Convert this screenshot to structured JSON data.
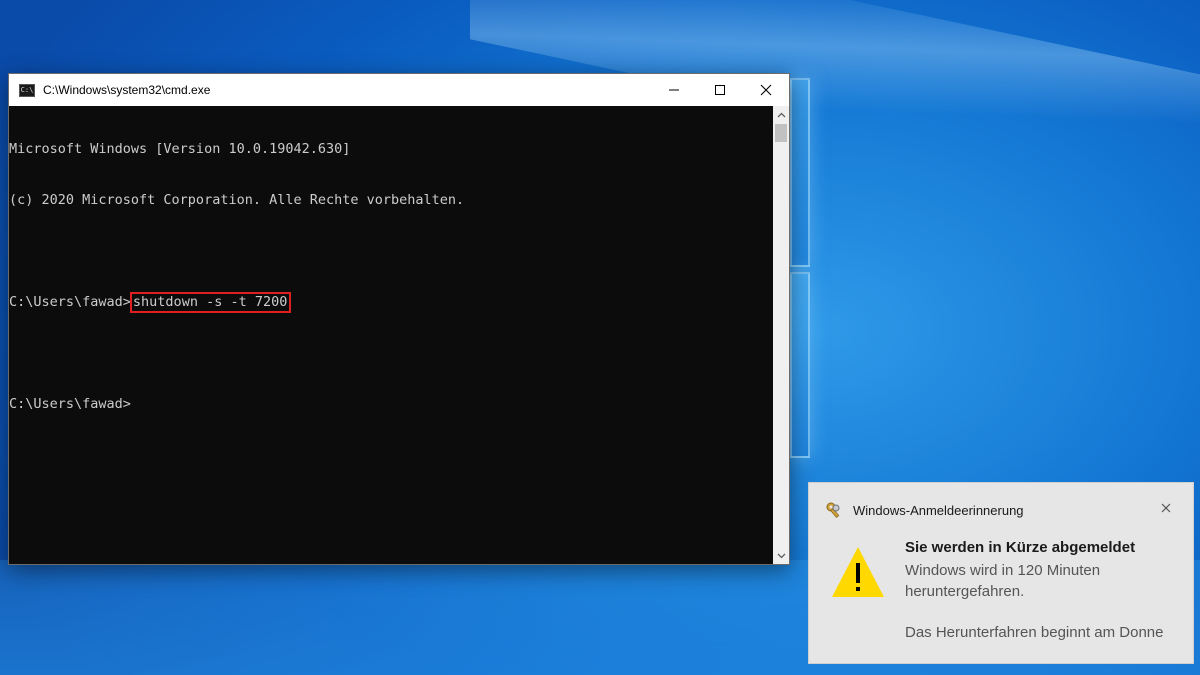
{
  "desktop": {
    "accent": "#0a5cc0"
  },
  "cmd": {
    "title": "C:\\Windows\\system32\\cmd.exe",
    "icon": "cmd-icon",
    "icon_text": "C:\\",
    "controls": [
      "minimize-icon",
      "maximize-icon",
      "close-icon"
    ],
    "lines": {
      "version": "Microsoft Windows [Version 10.0.19042.630]",
      "copyright": "(c) 2020 Microsoft Corporation. Alle Rechte vorbehalten.",
      "prompt1": "C:\\Users\\fawad>",
      "command": "shutdown -s -t 7200",
      "prompt2": "C:\\Users\\fawad>"
    },
    "highlight_color": "#e02020"
  },
  "toast": {
    "app_icon": "keys-icon",
    "app_name": "Windows-Anmeldeerinnerung",
    "title": "Sie werden in Kürze abgemeldet",
    "message": "Windows wird in 120 Minuten heruntergefahren.",
    "detail": "Das Herunterfahren beginnt am Donne",
    "warning_icon": "warning-icon",
    "warning_color": "#ffd800"
  }
}
